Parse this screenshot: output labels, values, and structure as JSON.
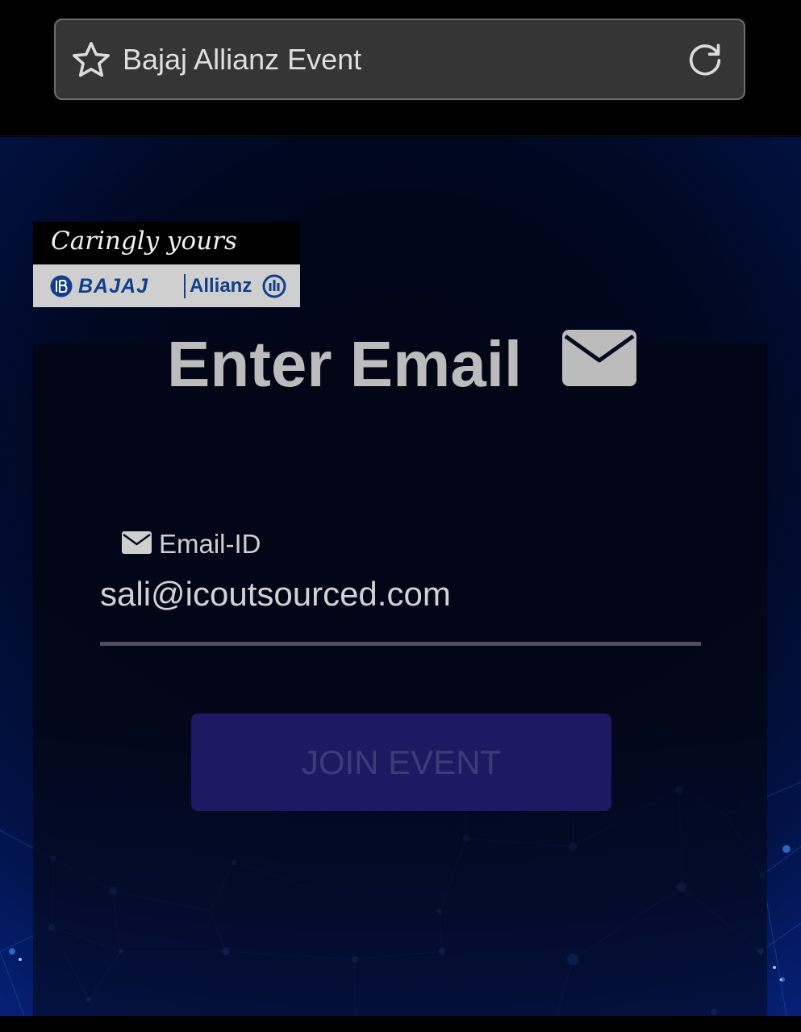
{
  "browser": {
    "page_title": "Bajaj Allianz Event",
    "bookmark_icon": "star-outline-icon",
    "reload_icon": "reload-icon"
  },
  "logo": {
    "tagline": "Caringly yours",
    "brand": "BAJAJ",
    "partner": "Allianz",
    "colors": {
      "brand_blue": "#113f8c",
      "strip": "#cfcfcf"
    }
  },
  "form": {
    "heading": "Enter Email",
    "heading_icon": "envelope-icon",
    "field_icon": "envelope-icon",
    "field_label": "Email-ID",
    "email_value": "sali@icoutsourced.com",
    "submit_label": "JOIN EVENT"
  },
  "colors": {
    "background_dark": "#000820",
    "background_edge": "#06227a",
    "button_fill": "#1c1a62",
    "button_text": "#3c3c78",
    "heading_text": "#bcbcbc"
  }
}
